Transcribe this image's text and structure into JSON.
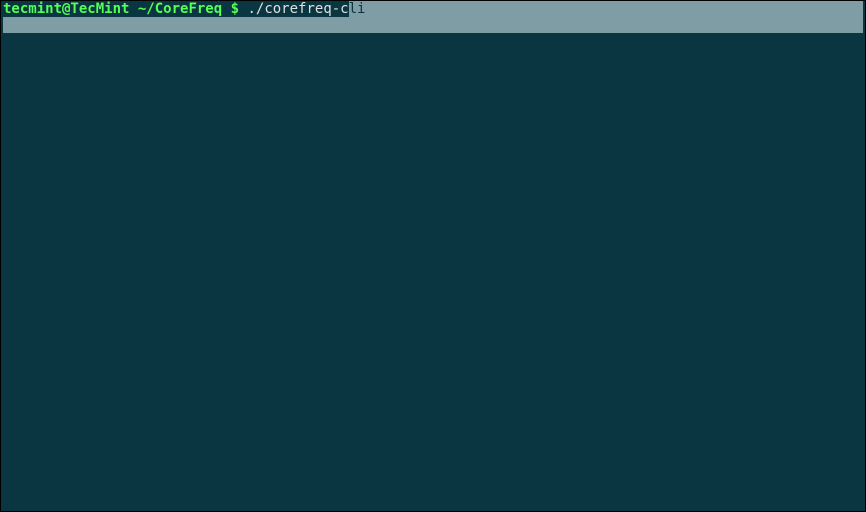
{
  "prompt": {
    "userhost": "tecmint@TecMint",
    "sep": " ",
    "path": "~/CoreFreq",
    "dollar": " $ "
  },
  "command": {
    "typed": "./corefreq-c",
    "suggestion_suffix": "li"
  }
}
